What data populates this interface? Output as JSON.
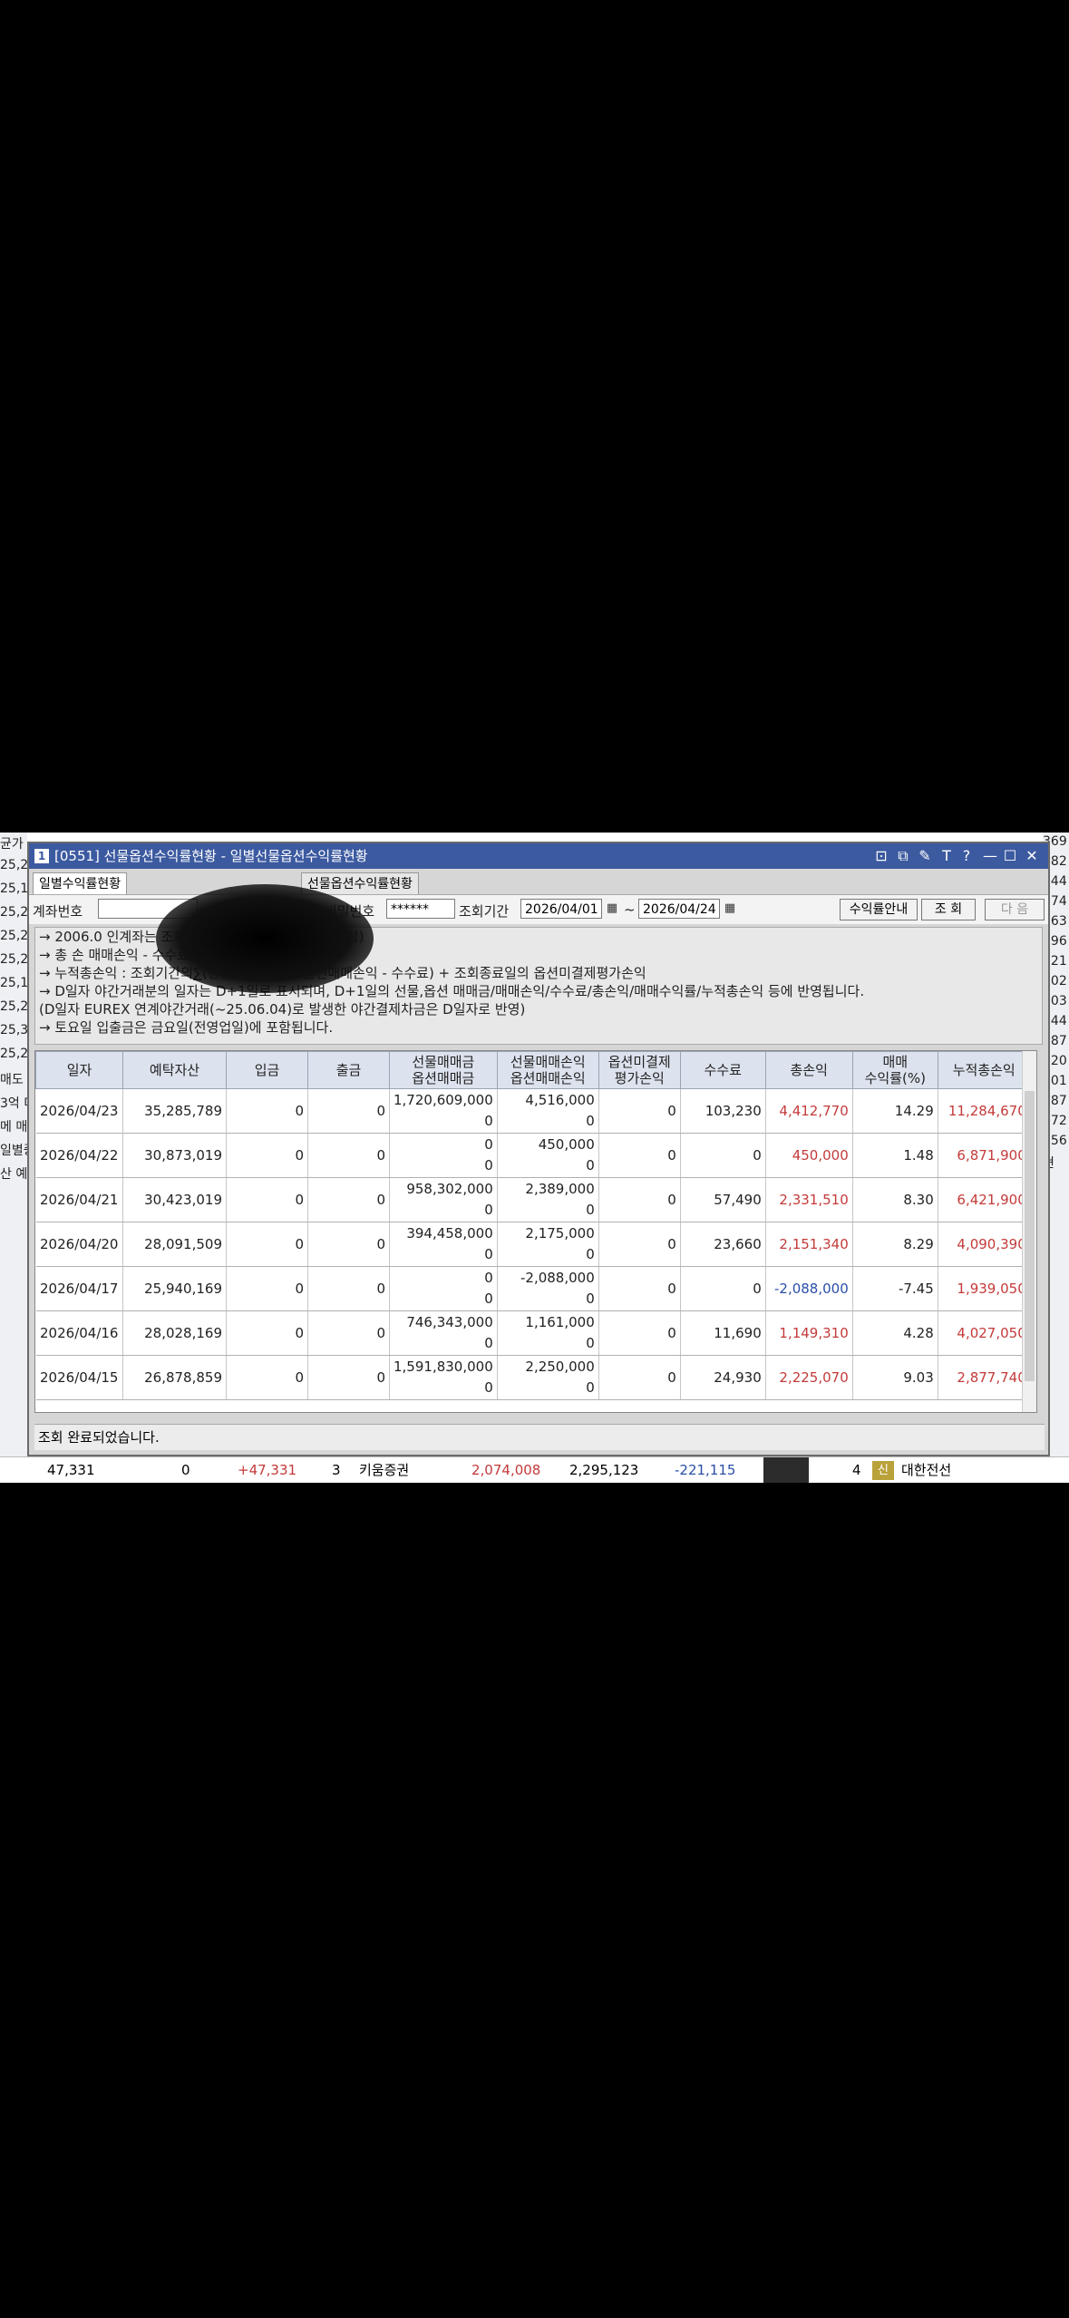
{
  "window": {
    "title": "[0551] 선물옵션수익률현황 - 일별선물옵션수익률현황",
    "icon_text": "1",
    "controls": [
      "⊡",
      "⧉",
      "✎",
      "T",
      "?",
      "—",
      "☐",
      "✕"
    ]
  },
  "tabs": [
    {
      "label": "일별수익률현황",
      "active": true
    },
    {
      "label": "선물옵션수익률현황",
      "active": false
    }
  ],
  "search": {
    "account_label": "계좌번호",
    "password_label": "비밀번호",
    "password_value": "******",
    "period_label": "조회기간",
    "date_from": "2026/04/01",
    "date_sep": "~",
    "date_to": "2026/04/24",
    "guide_button": "수익률안내",
    "query_button": "조 회",
    "next_button": "다 음"
  },
  "notes": [
    "→ 2006.0                                      인계좌는 조회되지 않습니다.(추후 제공 예정)",
    "→ 총  손                                      매매손익 - 수수료 + 옵션미결제평가손익",
    "→ 누적총손익 : 조회기간의∑(선물매매손익 + 옵션매매손익 - 수수료) + 조회종료일의 옵션미결제평가손익",
    "→ D일자 야간거래분의 일자는 D+1일로 표시되며, D+1일의 선물,옵션 매매금/매매손익/수수료/총손익/매매수익률/누적총손익 등에 반영됩니다.",
    "   (D일자 EUREX 연계야간거래(~25.06.04)로 발생한 야간결제차금은 D일자로 반영)",
    "→ 토요일 입출금은 금요일(전영업일)에 포함됩니다."
  ],
  "table": {
    "headers": [
      {
        "top": "일자"
      },
      {
        "top": "예탁자산"
      },
      {
        "top": "입금"
      },
      {
        "top": "출금"
      },
      {
        "top": "선물매매금",
        "bottom": "옵션매매금"
      },
      {
        "top": "선물매매손익",
        "bottom": "옵션매매손익"
      },
      {
        "top": "옵션미결제",
        "bottom": "평가손익"
      },
      {
        "top": "수수료"
      },
      {
        "top": "총손익"
      },
      {
        "top": "매매",
        "bottom": "수익률(%)"
      },
      {
        "top": "누적총손익"
      }
    ],
    "rows": [
      {
        "date": "2026/04/23",
        "deposit": "35,285,789",
        "in": "0",
        "out": "0",
        "fut_amt": "1,720,609,000",
        "opt_amt": "0",
        "fut_pl": "4,516,000",
        "opt_pl": "0",
        "eval": "0",
        "fee": "103,230",
        "total": "4,412,770",
        "total_color": "red",
        "rate": "14.29",
        "cum": "11,284,670",
        "cum_color": "red"
      },
      {
        "date": "2026/04/22",
        "deposit": "30,873,019",
        "in": "0",
        "out": "0",
        "fut_amt": "0",
        "opt_amt": "0",
        "fut_pl": "450,000",
        "opt_pl": "0",
        "eval": "0",
        "fee": "0",
        "total": "450,000",
        "total_color": "red",
        "rate": "1.48",
        "cum": "6,871,900",
        "cum_color": "red"
      },
      {
        "date": "2026/04/21",
        "deposit": "30,423,019",
        "in": "0",
        "out": "0",
        "fut_amt": "958,302,000",
        "opt_amt": "0",
        "fut_pl": "2,389,000",
        "opt_pl": "0",
        "eval": "0",
        "fee": "57,490",
        "total": "2,331,510",
        "total_color": "red",
        "rate": "8.30",
        "cum": "6,421,900",
        "cum_color": "red"
      },
      {
        "date": "2026/04/20",
        "deposit": "28,091,509",
        "in": "0",
        "out": "0",
        "fut_amt": "394,458,000",
        "opt_amt": "0",
        "fut_pl": "2,175,000",
        "opt_pl": "0",
        "eval": "0",
        "fee": "23,660",
        "total": "2,151,340",
        "total_color": "red",
        "rate": "8.29",
        "cum": "4,090,390",
        "cum_color": "red"
      },
      {
        "date": "2026/04/17",
        "deposit": "25,940,169",
        "in": "0",
        "out": "0",
        "fut_amt": "0",
        "opt_amt": "0",
        "fut_pl": "-2,088,000",
        "opt_pl": "0",
        "eval": "0",
        "fee": "0",
        "total": "-2,088,000",
        "total_color": "blue",
        "rate": "-7.45",
        "cum": "1,939,050",
        "cum_color": "red"
      },
      {
        "date": "2026/04/16",
        "deposit": "28,028,169",
        "in": "0",
        "out": "0",
        "fut_amt": "746,343,000",
        "opt_amt": "0",
        "fut_pl": "1,161,000",
        "opt_pl": "0",
        "eval": "0",
        "fee": "11,690",
        "total": "1,149,310",
        "total_color": "red",
        "rate": "4.28",
        "cum": "4,027,050",
        "cum_color": "red"
      },
      {
        "date": "2026/04/15",
        "deposit": "26,878,859",
        "in": "0",
        "out": "0",
        "fut_amt": "1,591,830,000",
        "opt_amt": "0",
        "fut_pl": "2,250,000",
        "opt_pl": "0",
        "eval": "0",
        "fee": "24,930",
        "total": "2,225,070",
        "total_color": "red",
        "rate": "9.03",
        "cum": "2,877,740",
        "cum_color": "red"
      }
    ]
  },
  "status_text": "조회 완료되었습니다.",
  "bottom_strip": {
    "c1": "47,331",
    "c2": "0",
    "c3": "+47,331",
    "c4": "3",
    "c5": "키움증권",
    "c6": "2,074,008",
    "c7": "2,295,123",
    "c8": "-221,115",
    "c9": "4",
    "badge": "신",
    "c10": "대한전선"
  },
  "bg_left": [
    "균가",
    "25,2",
    "25,1",
    "25,2",
    "25,2",
    "25,2",
    "25,1",
    "25,2",
    "25,3",
    "25,2",
    "매도",
    "3억 더",
    "메 매",
    "일별중",
    "산 예"
  ],
  "bg_right": [
    "369",
    "482",
    "744",
    "574",
    "563",
    "396",
    "021",
    "802",
    "703",
    "844",
    "887",
    "920",
    "701",
    "287",
    "872",
    "156",
    "현"
  ]
}
